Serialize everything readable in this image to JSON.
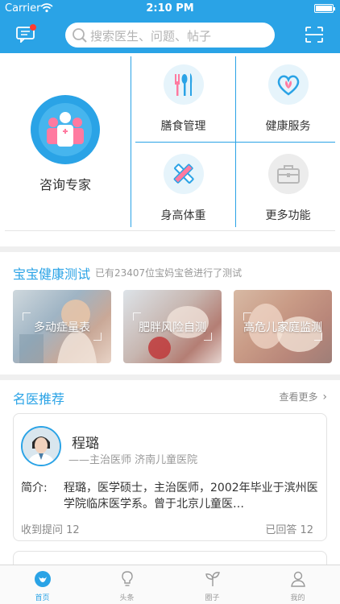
{
  "status_bar": {
    "carrier": "Carrier",
    "time": "2:10 PM",
    "battery_level": 1.0
  },
  "header": {
    "search_placeholder": "搜索医生、问题、帖子",
    "accent": "#2aa3e6",
    "message_icon": "chat-bubble-icon",
    "scan_icon": "scan-icon"
  },
  "grid": {
    "consult": {
      "label": "咨询专家",
      "icon": "doctors-group-icon"
    },
    "items": [
      {
        "label": "膳食管理",
        "icon": "fork-spoon-icon"
      },
      {
        "label": "健康服务",
        "icon": "heart-leaf-icon"
      },
      {
        "label": "身高体重",
        "icon": "ruler-pencil-icon"
      },
      {
        "label": "更多功能",
        "icon": "toolbox-icon"
      }
    ]
  },
  "health_test": {
    "title": "宝宝健康测试",
    "subtitle": "已有23407位宝妈宝爸进行了测试",
    "cards": [
      {
        "label": "多动症量表"
      },
      {
        "label": "肥胖风险自测"
      },
      {
        "label": "高危儿家庭监测"
      }
    ]
  },
  "doctors": {
    "title": "名医推荐",
    "more": "查看更多",
    "card": {
      "name": "程璐",
      "meta": "——主治医师 济南儿童医院",
      "bio_label": "简介:",
      "bio": "程璐，医学硕士，主治医师，2002年毕业于滨州医学院临床医学系。曾于北京儿童医…",
      "questions": "收到提问 12",
      "answered": "已回答 12"
    }
  },
  "tabbar": {
    "tabs": [
      {
        "label": "首页",
        "icon": "home-drop-icon",
        "active": true
      },
      {
        "label": "头条",
        "icon": "lightbulb-icon",
        "active": false
      },
      {
        "label": "圈子",
        "icon": "sprout-icon",
        "active": false
      },
      {
        "label": "我的",
        "icon": "person-icon",
        "active": false
      }
    ]
  }
}
